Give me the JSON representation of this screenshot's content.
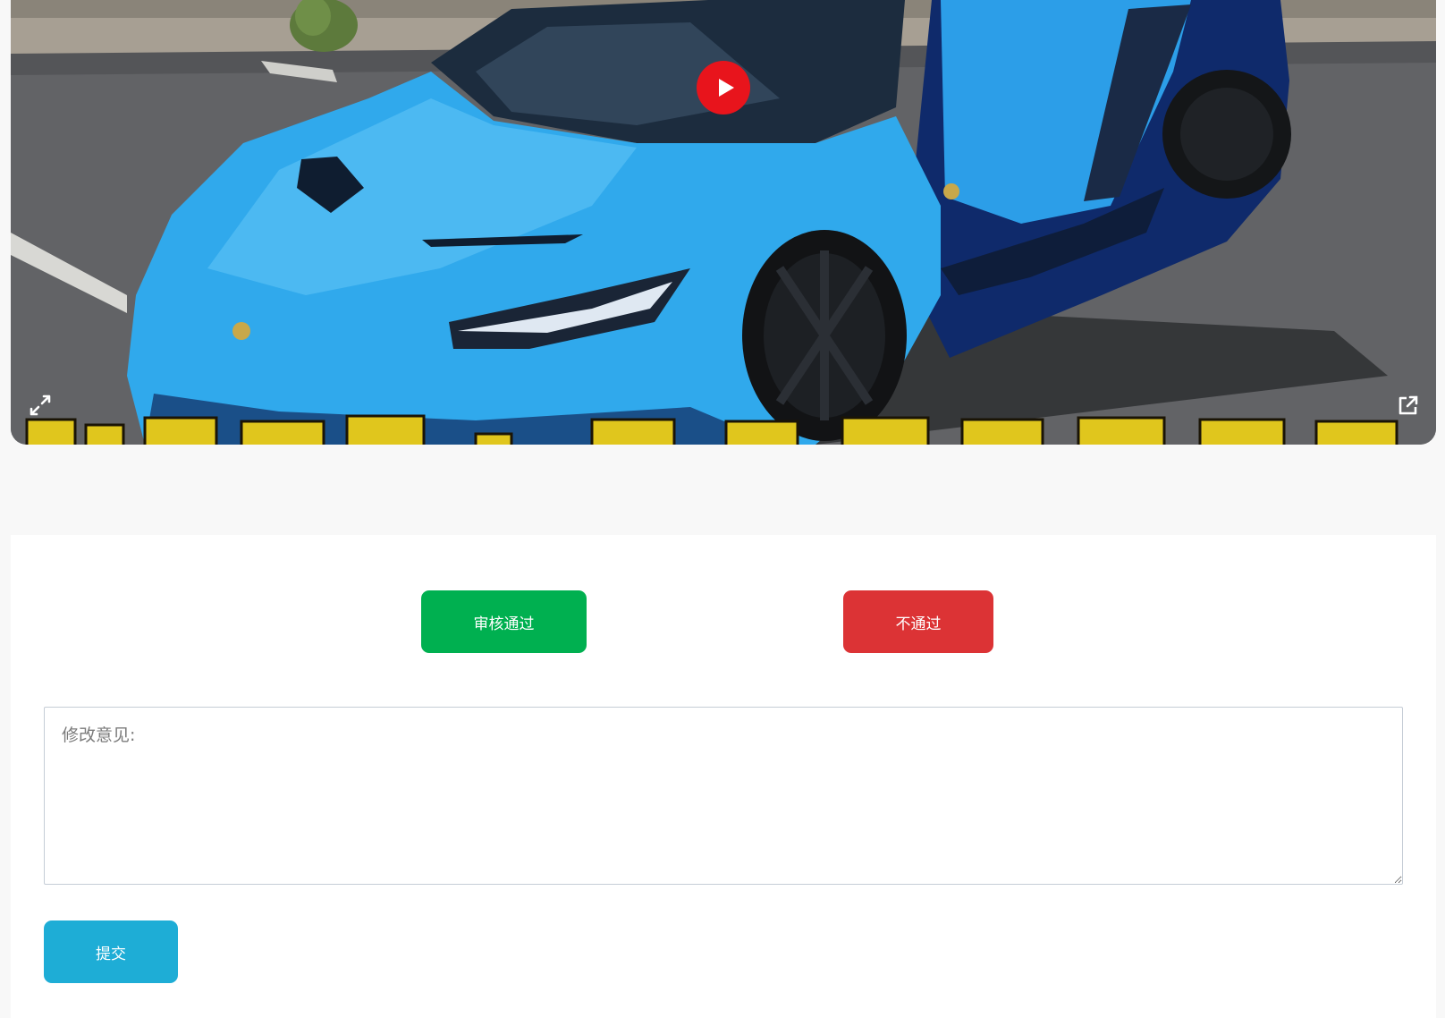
{
  "video": {
    "play_icon": "play-icon",
    "fullscreen_icon": "expand-icon",
    "external_icon": "external-link-icon",
    "caption_band_color": "#e0c61d"
  },
  "review": {
    "approve_label": "审核通过",
    "reject_label": "不通过",
    "comments_placeholder": "修改意见:",
    "submit_label": "提交"
  },
  "colors": {
    "approve": "#00b050",
    "reject": "#dc3335",
    "submit": "#1eadd6",
    "car_body": "#2fa7ea"
  }
}
